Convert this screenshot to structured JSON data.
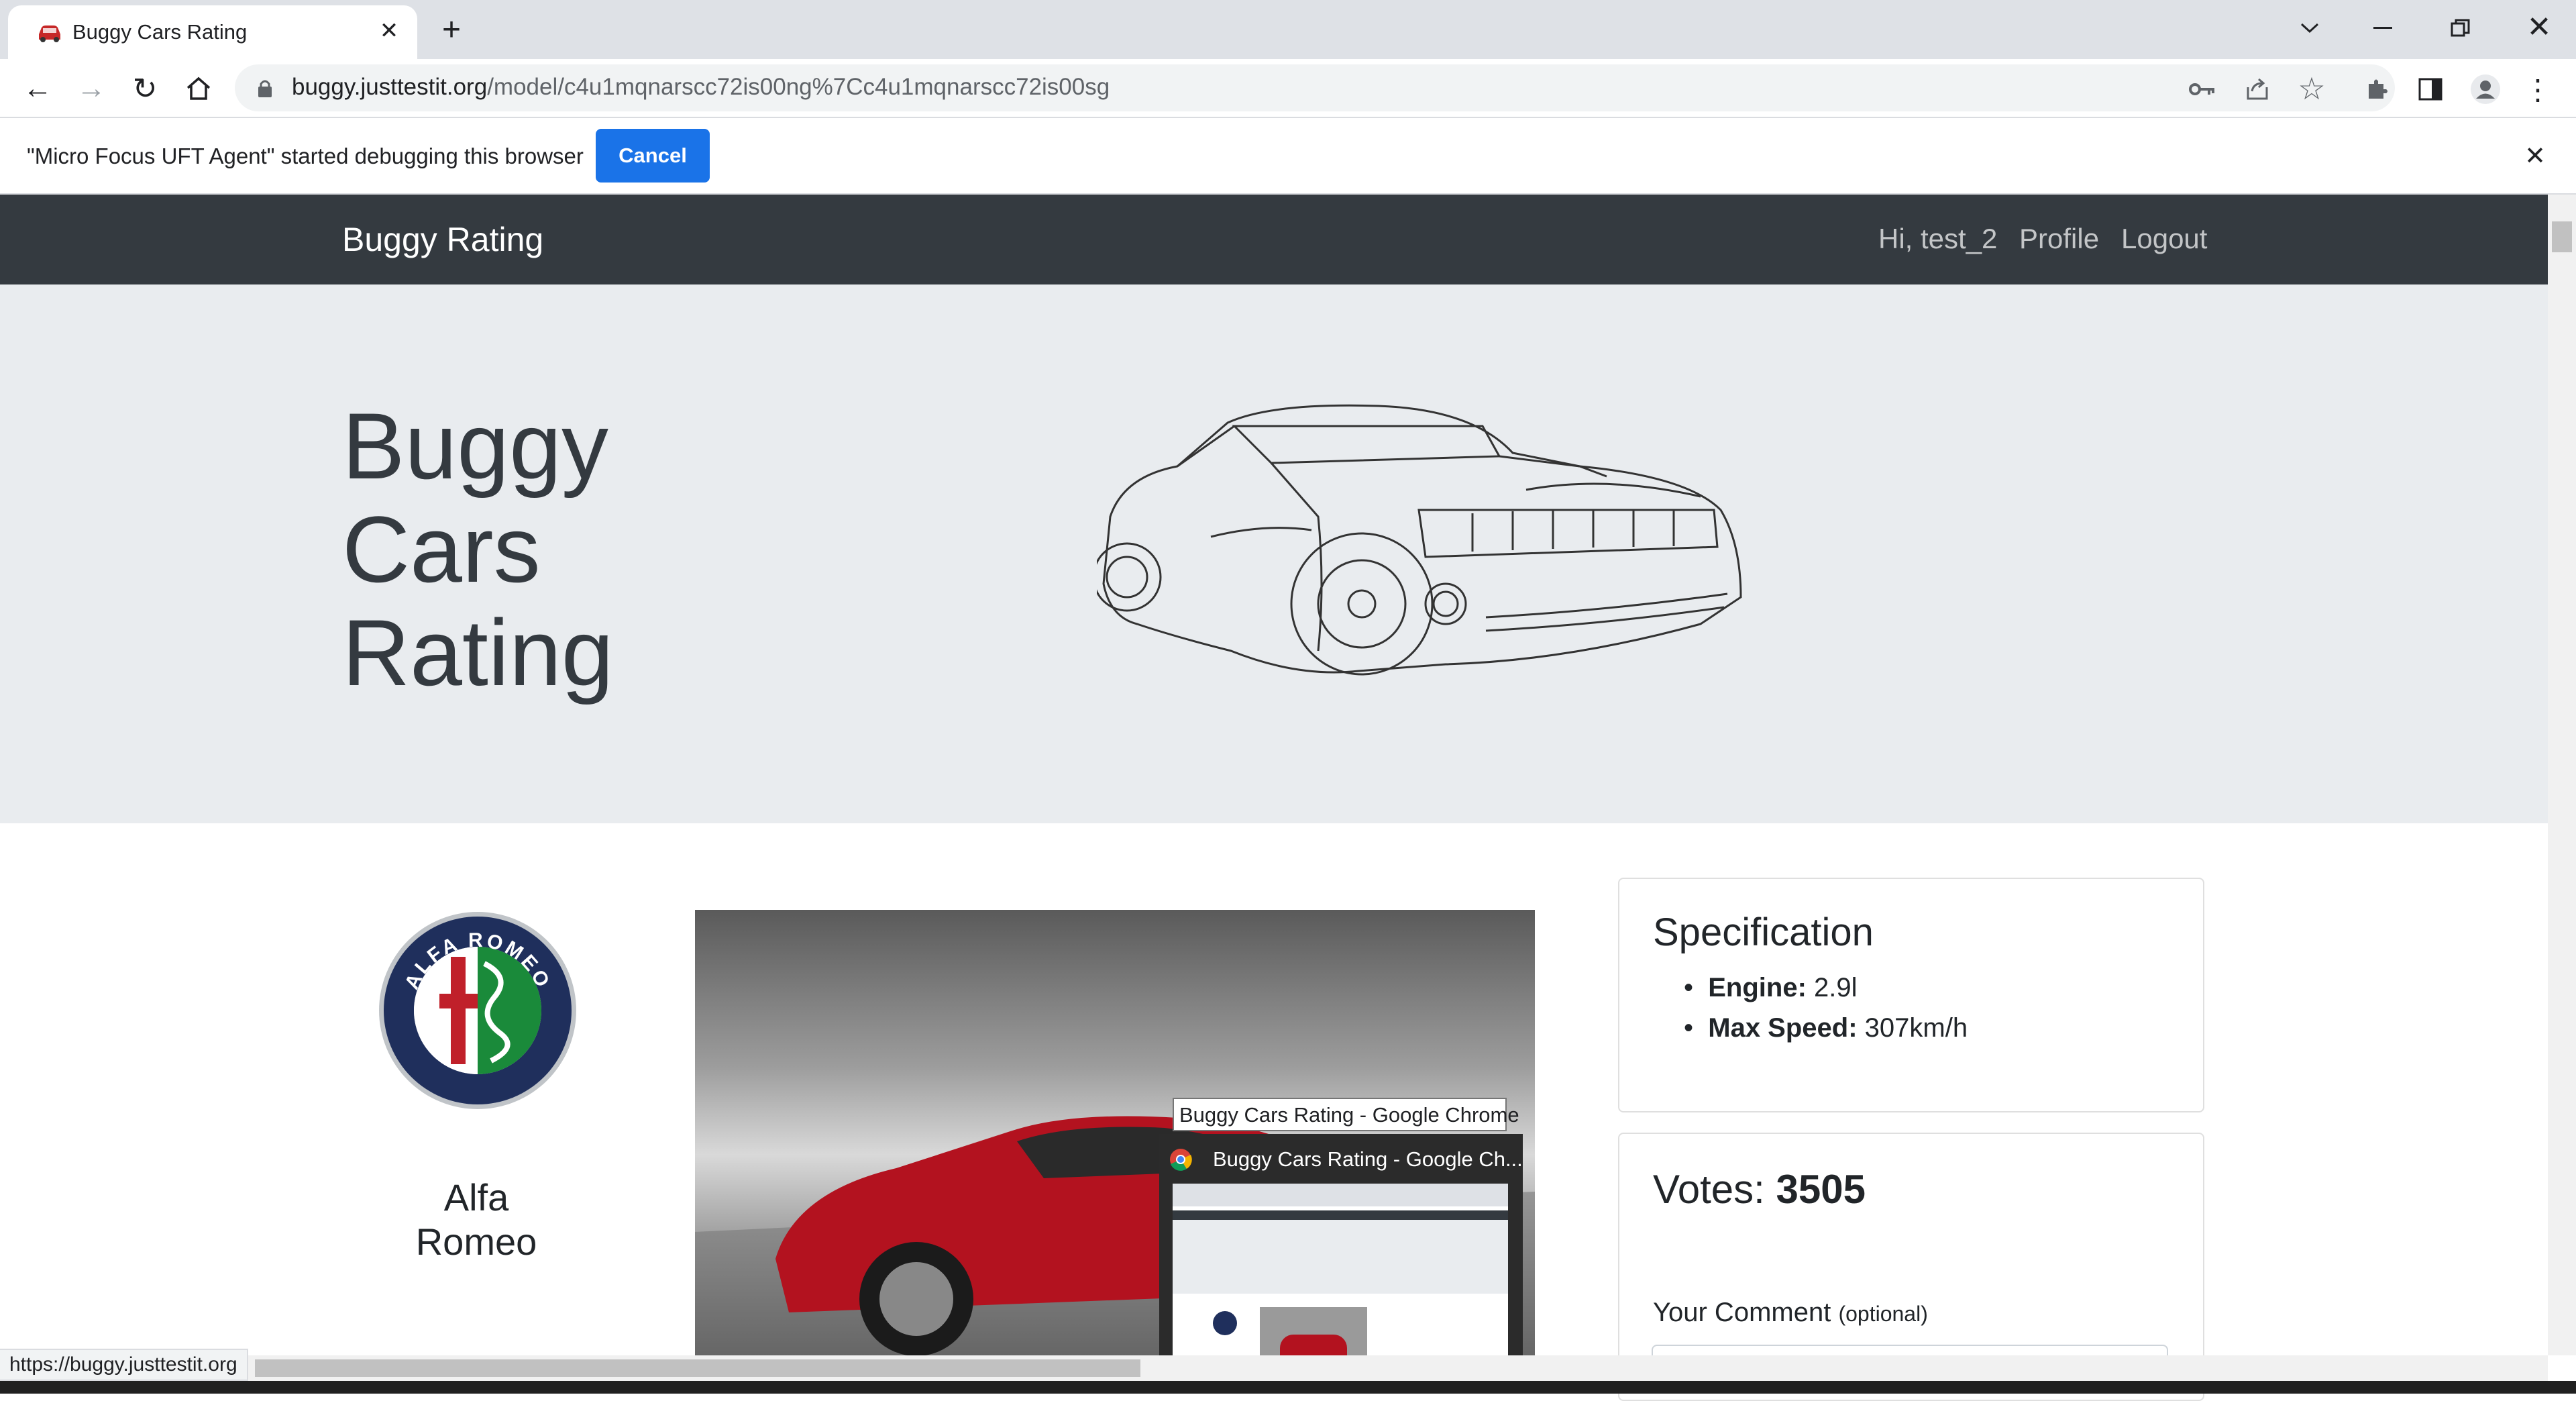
{
  "browser": {
    "tab_title": "Buggy Cars Rating",
    "new_tab_label": "+",
    "url_host": "buggy.justtestit.org",
    "url_path": "/model/c4u1mqnarscc72is00ng%7Cc4u1mqnarscc72is00sg",
    "status_url": "https://buggy.justtestit.org"
  },
  "infobar": {
    "message": "\"Micro Focus UFT Agent\" started debugging this browser",
    "cancel_label": "Cancel"
  },
  "navbar": {
    "brand": "Buggy Rating",
    "greeting": "Hi, test_2",
    "profile": "Profile",
    "logout": "Logout"
  },
  "hero": {
    "title_line1": "Buggy",
    "title_line2": "Cars",
    "title_line3": "Rating"
  },
  "model": {
    "make_line1": "Alfa",
    "make_line2": "Romeo",
    "logo_text": "ALFA ROMEO"
  },
  "specification": {
    "heading": "Specification",
    "items": [
      {
        "label": "Engine:",
        "value": "2.9l"
      },
      {
        "label": "Max Speed:",
        "value": "307km/h"
      }
    ]
  },
  "votes": {
    "label": "Votes:",
    "count": "3505",
    "comment_label": "Your Comment",
    "comment_hint": "(optional)"
  },
  "tooltip": {
    "title": "Buggy Cars Rating - Google Chrome",
    "preview_title": "Buggy Cars Rating - Google Ch..."
  },
  "colors": {
    "navbar_bg": "#343a40",
    "jumbotron_bg": "#e9ecef",
    "chrome_blue": "#1a73e8",
    "car_red": "#b3121f"
  }
}
